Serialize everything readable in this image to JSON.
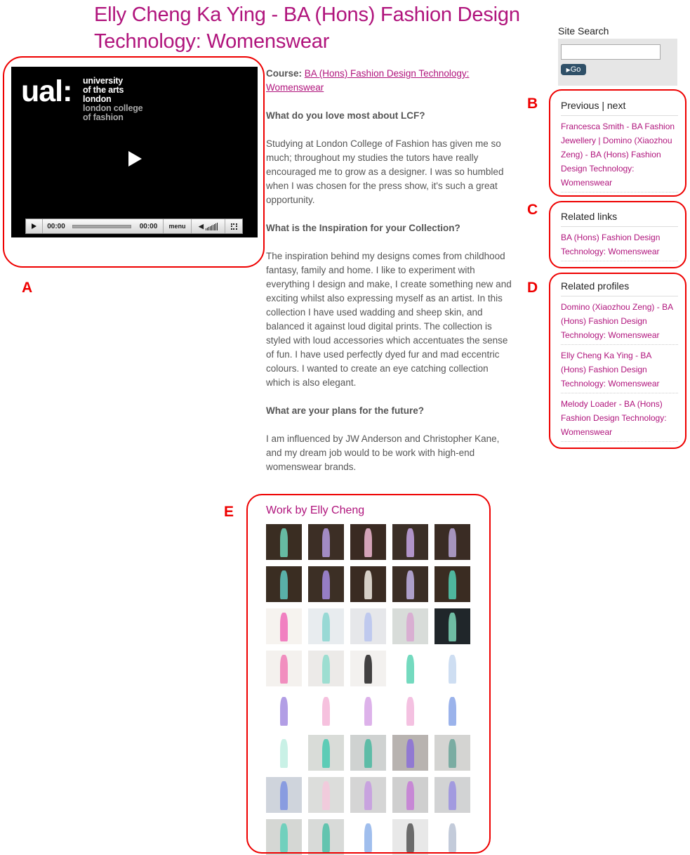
{
  "page": {
    "title": "Elly Cheng Ka Ying - BA (Hons) Fashion Design Technology: Womenswear"
  },
  "video": {
    "logo_mark": "ual:",
    "logo_lines_white": [
      "university",
      "of the arts",
      "london"
    ],
    "logo_lines_grey": [
      "london college",
      "of fashion"
    ],
    "time_current": "00:00",
    "time_total": "00:00",
    "menu_label": "menu",
    "progress_fraction": 0
  },
  "article": {
    "course_label": "Course:",
    "course_link": "BA (Hons) Fashion Design Technology: Womenswear",
    "q1": "What do you love most about LCF?",
    "a1": "Studying at London College of Fashion has given me so much; throughout my studies the tutors have really encouraged me to grow as a designer. I was so humbled when I was chosen for the press show, it's such a great opportunity.",
    "q2": "What is the Inspiration for your Collection?",
    "a2": "The inspiration behind my designs comes from childhood fantasy, family and home. I like to experiment with everything I design and make, I create something new and exciting whilst also expressing myself as an artist. In this collection I have used wadding and sheep skin, and balanced it against loud digital prints. The collection is styled with loud accessories which accentuates the sense of fun. I have used perfectly dyed fur and mad eccentric colours. I wanted to create an eye catching collection which is also elegant.",
    "q3": "What are your plans for the future?",
    "a3": "I am influenced by JW Anderson and Christopher Kane, and my dream job would to be work with high-end womenswear brands."
  },
  "gallery": {
    "heading": "Work by Elly Cheng",
    "thumb_count": 40
  },
  "sidebar": {
    "search": {
      "label": "Site Search",
      "value": "",
      "go_label": "Go"
    },
    "prevnext": {
      "previous_label": "Previous",
      "separator": "|",
      "next_label": "next",
      "text": "Francesca Smith - BA Fashion Jewellery | Domino (Xiaozhou Zeng) - BA (Hons) Fashion Design Technology: Womenswear"
    },
    "related_links": {
      "heading": "Related links",
      "items": [
        "BA (Hons) Fashion Design Technology: Womenswear"
      ]
    },
    "related_profiles": {
      "heading": "Related profiles",
      "items": [
        "Domino (Xiaozhou Zeng) - BA (Hons) Fashion Design Technology: Womenswear",
        "Elly Cheng Ka Ying - BA (Hons) Fashion Design Technology: Womenswear",
        "Melody Loader - BA (Hons) Fashion Design Technology: Womenswear"
      ]
    }
  },
  "annotations": {
    "labels": [
      "A",
      "B",
      "C",
      "D",
      "E"
    ],
    "color": "#ee0000"
  },
  "colors": {
    "accent": "#b0147c",
    "text": "#555555",
    "search_button": "#2f5068"
  }
}
